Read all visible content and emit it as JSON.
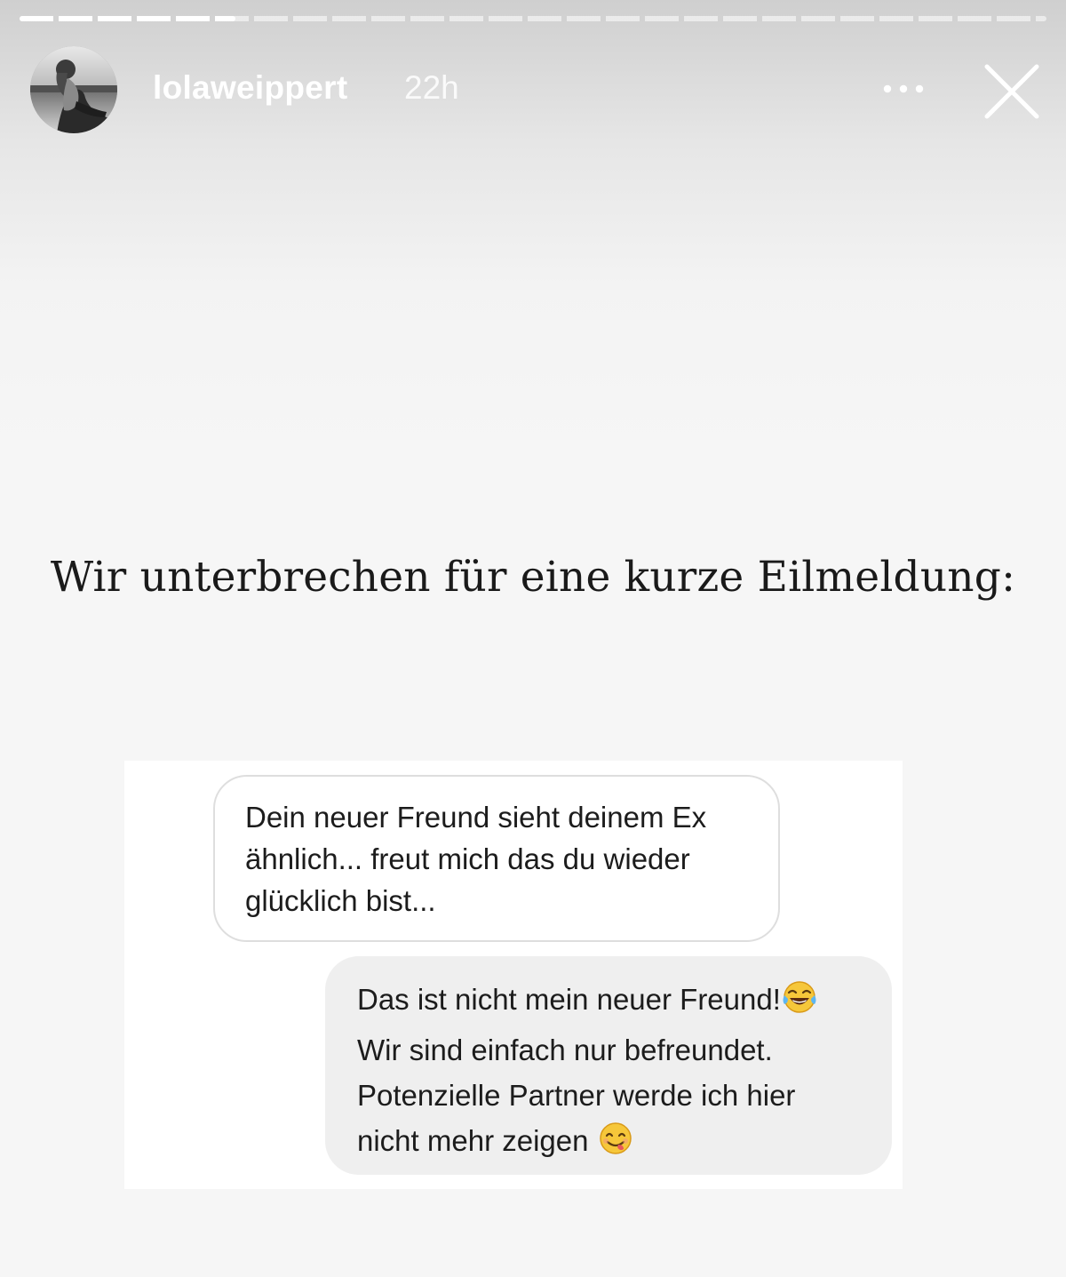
{
  "story": {
    "username": "lolaweippert",
    "timestamp": "22h",
    "progress_fraction": 0.21,
    "more_icon": "more-horizontal-icon",
    "close_icon": "close-icon"
  },
  "headline": "Wir unterbrechen für eine kurze Eilmeldung:",
  "chat": {
    "incoming": {
      "lines": [
        "Dein neuer Freund sieht deinem Ex",
        "ähnlich... freut mich das du wieder",
        "glücklich bist..."
      ]
    },
    "outgoing": {
      "lines": [
        "Das ist nicht mein neuer Freund!",
        "Wir sind einfach nur befreundet.",
        "Potenzielle Partner werde ich hier",
        "nicht mehr zeigen"
      ],
      "emoji_line1": "tears-of-joy-emoji",
      "emoji_line4": "yum-face-emoji"
    }
  },
  "colors": {
    "text_dark": "#1c1c1c",
    "outgoing_bubble": "#efefef",
    "incoming_border": "#dedede"
  }
}
